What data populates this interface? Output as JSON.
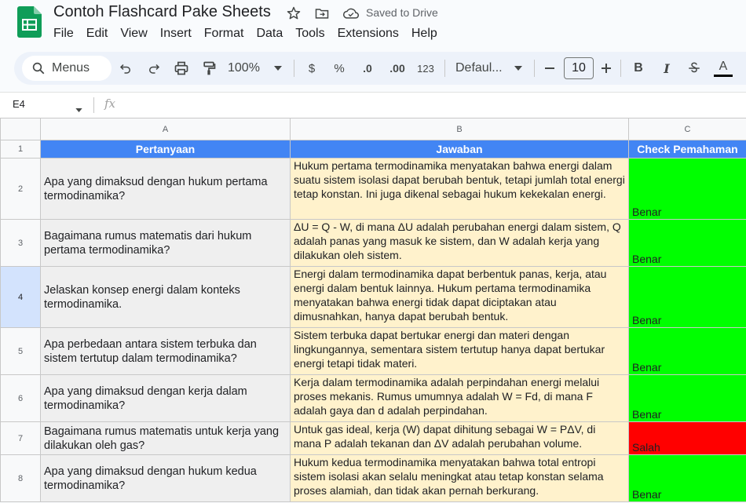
{
  "app": {
    "title": "Contoh Flashcard Pake Sheets",
    "saved_status": "Saved to Drive",
    "menus": [
      "File",
      "Edit",
      "View",
      "Insert",
      "Format",
      "Data",
      "Tools",
      "Extensions",
      "Help"
    ]
  },
  "toolbar": {
    "search_label": "Menus",
    "zoom": "100%",
    "currency": "$",
    "percent": "%",
    "decrease_decimal": ".0",
    "increase_decimal": ".00",
    "number_format": "123",
    "font": "Defaul...",
    "font_size": "10",
    "bold": "B",
    "italic": "I",
    "text_color": "A"
  },
  "formula_bar": {
    "cell_ref": "E4",
    "fx": "fx",
    "value": ""
  },
  "colors": {
    "header_fill": "#4285f4",
    "question_fill": "#efefef",
    "answer_fill": "#fff2cc",
    "correct_fill": "#00ff00",
    "wrong_fill": "#ff0000"
  },
  "sheet": {
    "column_letters": [
      "A",
      "B",
      "C"
    ],
    "headers": [
      "Pertanyaan",
      "Jawaban",
      "Check Pemahaman"
    ],
    "rows": [
      {
        "num": "2",
        "q": "Apa yang dimaksud dengan hukum pertama termodinamika?",
        "a": "Hukum pertama termodinamika menyatakan bahwa energi dalam suatu sistem isolasi dapat berubah bentuk, tetapi jumlah total energi tetap konstan. Ini juga dikenal sebagai hukum kekekalan energi.",
        "check": "Benar"
      },
      {
        "num": "3",
        "q": "Bagaimana rumus matematis dari hukum pertama termodinamika?",
        "a": "ΔU = Q - W, di mana ΔU adalah perubahan energi dalam sistem, Q adalah panas yang masuk ke sistem, dan W adalah kerja yang dilakukan oleh sistem.",
        "check": "Benar"
      },
      {
        "num": "4",
        "q": "Jelaskan konsep energi dalam konteks termodinamika.",
        "a": "Energi dalam termodinamika dapat berbentuk panas, kerja, atau energi dalam bentuk lainnya. Hukum pertama termodinamika menyatakan bahwa energi tidak dapat diciptakan atau dimusnahkan, hanya dapat berubah bentuk.",
        "check": "Benar"
      },
      {
        "num": "5",
        "q": "Apa perbedaan antara sistem terbuka dan sistem tertutup dalam termodinamika?",
        "a": "Sistem terbuka dapat bertukar energi dan materi dengan lingkungannya, sementara sistem tertutup hanya dapat bertukar energi tetapi tidak materi.",
        "check": "Benar"
      },
      {
        "num": "6",
        "q": "Apa yang dimaksud dengan kerja dalam termodinamika?",
        "a": "Kerja dalam termodinamika adalah perpindahan energi melalui proses mekanis. Rumus umumnya adalah W = Fd, di mana F adalah gaya dan d adalah perpindahan.",
        "check": "Benar"
      },
      {
        "num": "7",
        "q": "Bagaimana rumus matematis untuk kerja yang dilakukan oleh gas?",
        "a": "Untuk gas ideal, kerja (W) dapat dihitung sebagai W = PΔV, di mana P adalah tekanan dan ΔV adalah perubahan volume.",
        "check": "Salah"
      },
      {
        "num": "8",
        "q": "Apa yang dimaksud dengan hukum kedua termodinamika?",
        "a": "Hukum kedua termodinamika menyatakan bahwa total entropi sistem isolasi akan selalu meningkat atau tetap konstan selama proses alamiah, dan tidak akan pernah berkurang.",
        "check": "Benar"
      }
    ]
  }
}
